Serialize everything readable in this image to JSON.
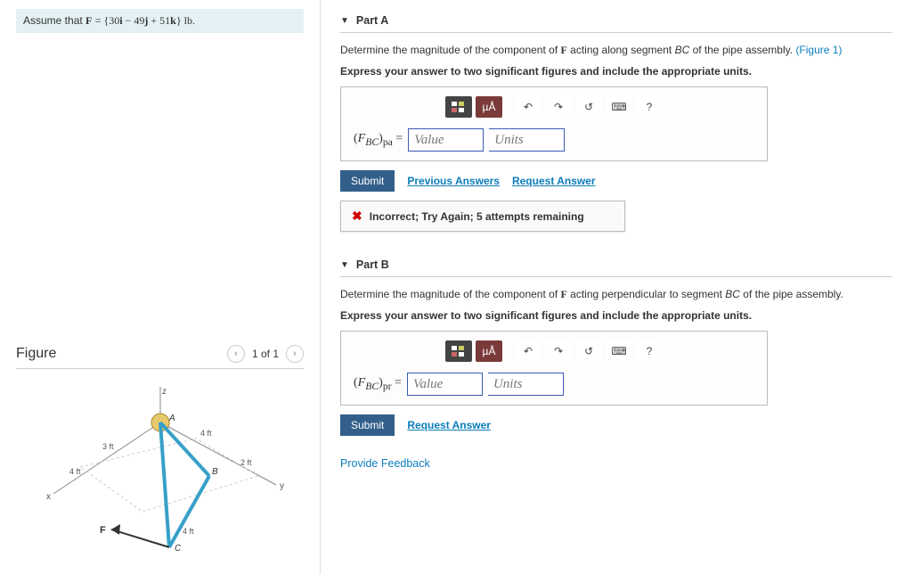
{
  "given": {
    "prefix": "Assume that ",
    "F_label": "F",
    "eq": " = {30",
    "i": "i",
    "minus": " − 49",
    "j": "j",
    "plus": " + 51",
    "k": "k",
    "suffix": "} lb."
  },
  "figure": {
    "title": "Figure",
    "pager": "1 of 1",
    "labels": {
      "A": "A",
      "B": "B",
      "C": "C",
      "F": "F",
      "x": "x",
      "y": "y",
      "z": "z",
      "d3": "3 ft",
      "d4a": "4 ft",
      "d4b": "4 ft",
      "d4c": "4 ft",
      "d2": "2 ft"
    }
  },
  "partA": {
    "title": "Part A",
    "prompt_pre": "Determine the magnitude of the component of ",
    "prompt_var": "F",
    "prompt_mid": " acting along segment ",
    "seg": "BC",
    "prompt_post": " of the pipe assembly.",
    "fig_ref": "(Figure 1)",
    "instruct": "Express your answer to two significant figures and include the appropriate units.",
    "var_html": "(F_BC)_pa =",
    "value_ph": "Value",
    "units_ph": "Units",
    "submit": "Submit",
    "prev": "Previous Answers",
    "req": "Request Answer",
    "feedback": "Incorrect; Try Again; 5 attempts remaining",
    "toolbar": {
      "mu": "µÅ",
      "undo": "↶",
      "redo": "↷",
      "reset": "↺",
      "kb": "⌨",
      "help": "?"
    }
  },
  "partB": {
    "title": "Part B",
    "prompt_pre": "Determine the magnitude of the component of ",
    "prompt_var": "F",
    "prompt_mid": " acting perpendicular to segment ",
    "seg": "BC",
    "prompt_post": " of the pipe assembly.",
    "instruct": "Express your answer to two significant figures and include the appropriate units.",
    "var_html": "(F_BC)_pr =",
    "value_ph": "Value",
    "units_ph": "Units",
    "submit": "Submit",
    "req": "Request Answer",
    "toolbar": {
      "mu": "µÅ",
      "undo": "↶",
      "redo": "↷",
      "reset": "↺",
      "kb": "⌨",
      "help": "?"
    }
  },
  "provide_feedback": "Provide Feedback"
}
